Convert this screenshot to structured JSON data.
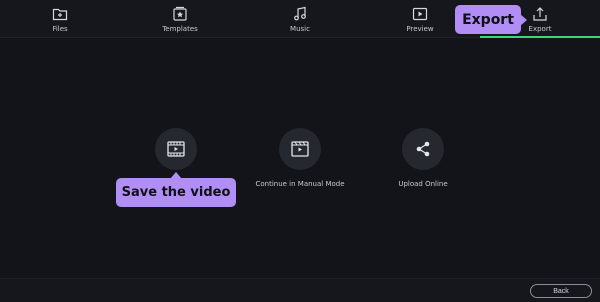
{
  "nav": {
    "files": "Files",
    "templates": "Templates",
    "music": "Music",
    "preview": "Preview",
    "export": "Export"
  },
  "tooltips": {
    "export": "Export",
    "save_video": "Save the video"
  },
  "options": {
    "save": "",
    "manual": "Continue in Manual Mode",
    "upload": "Upload Online"
  },
  "footer": {
    "back": "Back"
  },
  "colors": {
    "background": "#131419",
    "accent_tooltip": "#b08ef5",
    "active_indicator": "#3bd57a",
    "icon_circle": "#262830"
  },
  "icons": [
    "folder-plus-icon",
    "templates-icon",
    "music-note-icon",
    "play-icon",
    "export-icon",
    "film-play-icon",
    "share-icon"
  ]
}
